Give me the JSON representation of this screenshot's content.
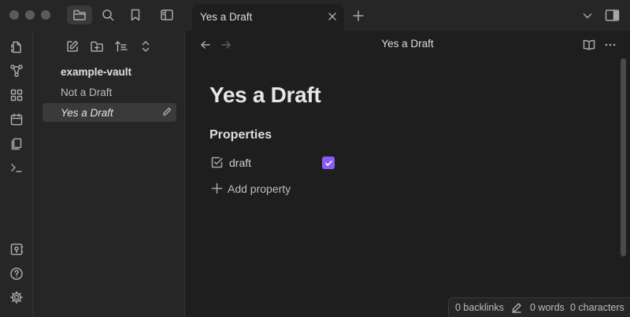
{
  "tab": {
    "title": "Yes a Draft"
  },
  "sidebar": {
    "vault_name": "example-vault",
    "files": [
      {
        "label": "Not a Draft",
        "active": false
      },
      {
        "label": "Yes a Draft",
        "active": true
      }
    ]
  },
  "view": {
    "title": "Yes a Draft"
  },
  "note": {
    "title": "Yes a Draft",
    "properties_heading": "Properties",
    "properties": [
      {
        "name": "draft",
        "type": "checkbox",
        "checked": true
      }
    ],
    "add_property_label": "Add property"
  },
  "status": {
    "backlinks": "0 backlinks",
    "words": "0 words",
    "characters": "0 characters"
  },
  "colors": {
    "accent": "#8a5cf5",
    "background": "#1e1e1e",
    "sidebar": "#262626"
  },
  "icons": {
    "titlebar": [
      "folder-icon",
      "search-icon",
      "bookmark-icon",
      "sidebar-toggle-icon",
      "close-icon",
      "plus-icon",
      "chevron-down-icon",
      "right-sidebar-icon"
    ],
    "ribbon": [
      "files-switcher-icon",
      "graph-icon",
      "canvas-icon",
      "calendar-icon",
      "templates-icon",
      "terminal-icon",
      "vault-icon",
      "help-icon",
      "settings-icon"
    ]
  }
}
